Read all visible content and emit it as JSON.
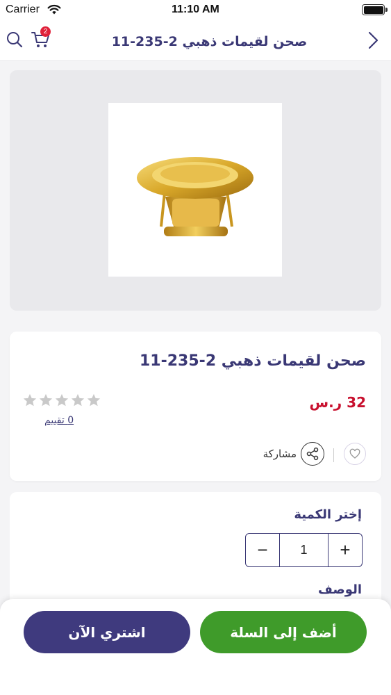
{
  "status_bar": {
    "carrier": "Carrier",
    "time": "11:10 AM"
  },
  "header": {
    "title": "صحن لقيمات ذهبي 2-235-11",
    "cart_count": "2",
    "icons": {
      "search": "search-icon",
      "cart": "cart-icon",
      "back": "chevron-right-icon"
    }
  },
  "product": {
    "title": "صحن لقيمات ذهبي 2-235-11",
    "price": "32 ر.س",
    "rating_stars": 0,
    "ratings_link": "0  تقييم",
    "share_label": "مشاركة",
    "image_alt": "gold-serving-plate"
  },
  "quantity": {
    "label": "إختر الكمية",
    "minus": "−",
    "value": "1",
    "plus": "+",
    "description_label": "الوصف"
  },
  "actions": {
    "buy_now": "اشتري الآن",
    "add_to_cart": "أضف إلى السلة"
  },
  "colors": {
    "brand_purple": "#3a3875",
    "price_red": "#c8102e",
    "add_green": "#3f9b2a",
    "buy_purple": "#3f3a7e",
    "badge_red": "#e0213a"
  }
}
